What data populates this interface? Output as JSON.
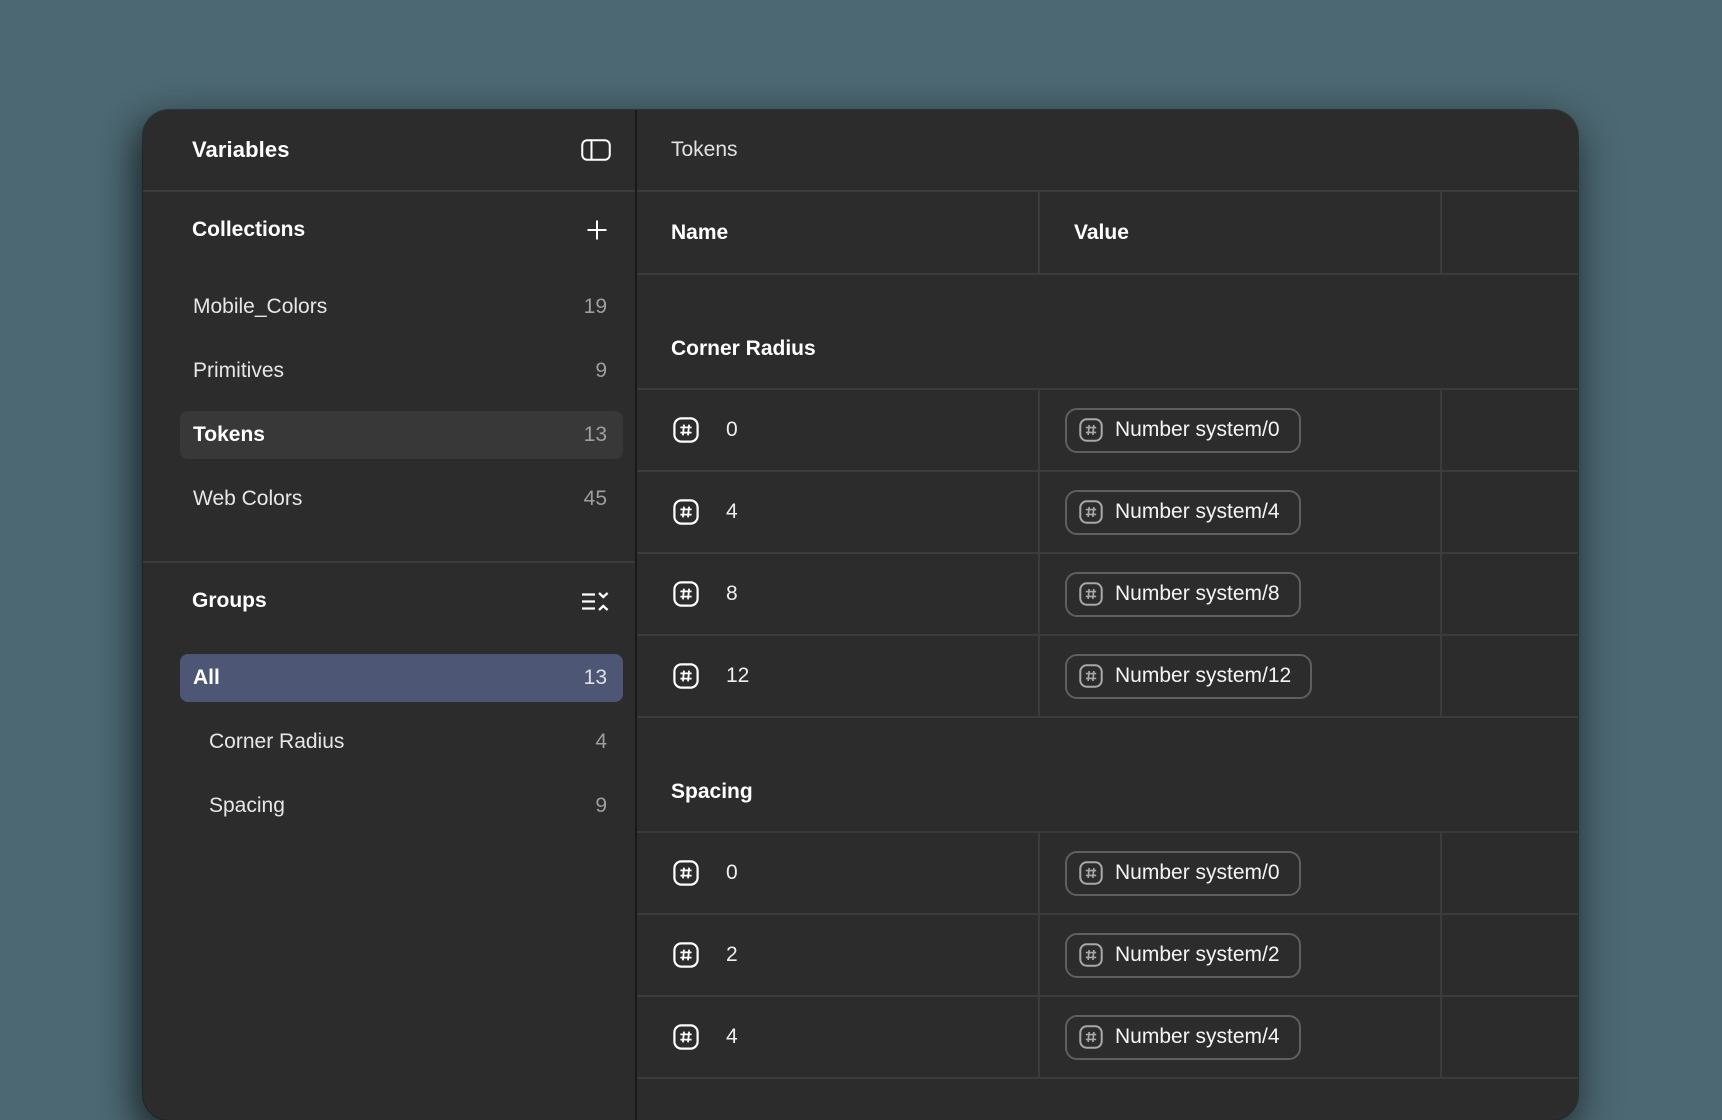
{
  "colors": {
    "desktop_bg": "#4C6872",
    "window_bg": "#2C2C2C",
    "divider": "#3B3B3B",
    "panel_divider": "#191919",
    "selected_item_bg": "#383838",
    "selected_group_bg": "#4D5674",
    "count": "#9E9E9E",
    "chip_border": "#5F5F5F",
    "chip_icon": "#A8A8A8"
  },
  "icons": {
    "sidebar_toggle": "panel-layout-icon",
    "add_collection": "plus-icon",
    "collapse_groups": "collapse-list-icon",
    "number_variable": "number-variable-icon"
  },
  "sidebar": {
    "title": "Variables",
    "collections": {
      "label": "Collections",
      "items": [
        {
          "label": "Mobile_Colors",
          "count": "19",
          "selected": false,
          "indent": false
        },
        {
          "label": "Primitives",
          "count": "9",
          "selected": false,
          "indent": false
        },
        {
          "label": "Tokens",
          "count": "13",
          "selected": true,
          "indent": false
        },
        {
          "label": "Web Colors",
          "count": "45",
          "selected": false,
          "indent": false
        }
      ]
    },
    "groups": {
      "label": "Groups",
      "items": [
        {
          "label": "All",
          "count": "13",
          "selected": true,
          "indent": false
        },
        {
          "label": "Corner Radius",
          "count": "4",
          "selected": false,
          "indent": true
        },
        {
          "label": "Spacing",
          "count": "9",
          "selected": false,
          "indent": true
        }
      ]
    }
  },
  "main": {
    "title": "Tokens",
    "columns": [
      "Name",
      "Value"
    ],
    "groups": [
      {
        "name": "Corner Radius",
        "rows": [
          {
            "name": "0",
            "value": "Number system/0"
          },
          {
            "name": "4",
            "value": "Number system/4"
          },
          {
            "name": "8",
            "value": "Number system/8"
          },
          {
            "name": "12",
            "value": "Number system/12"
          }
        ]
      },
      {
        "name": "Spacing",
        "rows": [
          {
            "name": "0",
            "value": "Number system/0"
          },
          {
            "name": "2",
            "value": "Number system/2"
          },
          {
            "name": "4",
            "value": "Number system/4"
          }
        ]
      }
    ]
  }
}
